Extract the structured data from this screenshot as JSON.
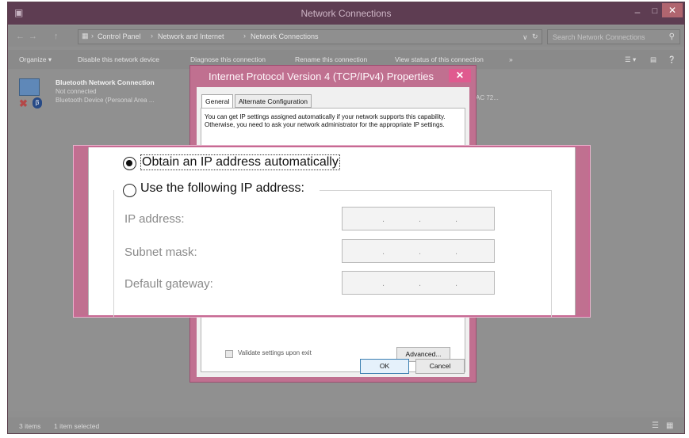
{
  "window": {
    "title": "Network Connections",
    "minimize_glyph": "–",
    "maximize_glyph": "□",
    "close_glyph": "✕"
  },
  "address": {
    "back_glyph": "←",
    "forward_glyph": "→",
    "up_glyph": "↑",
    "breadcrumbs": [
      "Control Panel",
      "Network and Internet",
      "Network Connections"
    ],
    "separator": "›",
    "search_placeholder": "Search Network Connections"
  },
  "commands": {
    "organize": "Organize ▾",
    "disable": "Disable this network device",
    "diagnose": "Diagnose this connection",
    "rename": "Rename this connection",
    "view_status": "View status of this connection",
    "more": "»"
  },
  "connection": {
    "name": "Bluetooth Network Connection",
    "status": "Not connected",
    "device": "Bluetooth Device (Personal Area ...",
    "other_device_fragment": "AC 72..."
  },
  "statusbar": {
    "items": "3 items",
    "selected": "1 item selected"
  },
  "dialog": {
    "title": "Internet Protocol Version 4 (TCP/IPv4) Properties",
    "tabs": [
      "General",
      "Alternate Configuration"
    ],
    "description": "You can get IP settings assigned automatically if your network supports this capability. Otherwise, you need to ask your network administrator for the appropriate IP settings.",
    "validate_label": "Validate settings upon exit",
    "advanced_label": "Advanced...",
    "ok_label": "OK",
    "cancel_label": "Cancel"
  },
  "zoom": {
    "obtain_auto_label": "Obtain an IP address automatically",
    "use_following_label": "Use the following IP address:",
    "ip_address_label": "IP address:",
    "subnet_mask_label": "Subnet mask:",
    "default_gateway_label": "Default gateway:",
    "selected_option": "obtain_auto"
  },
  "colors": {
    "accent": "#c07090",
    "close_red": "#e05a8f",
    "titlebar": "#5e3d52"
  }
}
